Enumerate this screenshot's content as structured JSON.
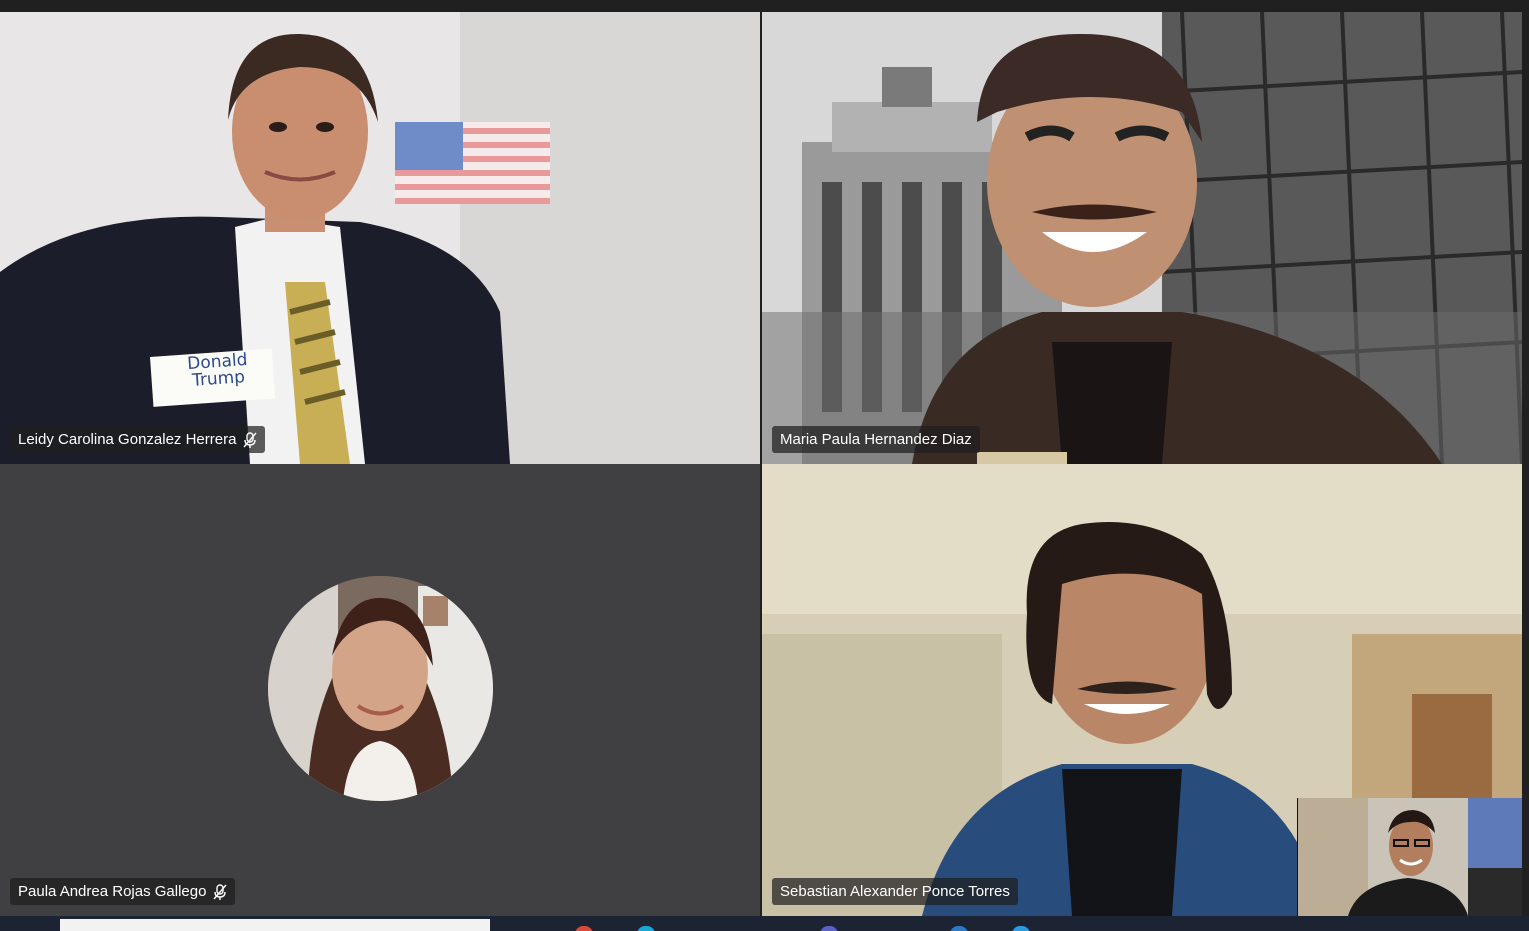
{
  "participants": {
    "tile_1": {
      "name": "Leidy Carolina Gonzalez Herrera",
      "muted": true,
      "name_tag_text": "Donald Trump"
    },
    "tile_2": {
      "name": "Maria Paula Hernandez Diaz",
      "muted": false
    },
    "tile_3": {
      "name": "Paula Andrea Rojas Gallego",
      "muted": true
    },
    "tile_4": {
      "name": "Sebastian Alexander Ponce Torres",
      "muted": false
    }
  },
  "icons": {
    "mute": "mic-off-icon",
    "taskbar_1": "chrome-icon",
    "taskbar_2": "edge-icon",
    "taskbar_3": "teams-icon",
    "taskbar_4": "folder-icon",
    "taskbar_5": "mail-icon"
  },
  "colors": {
    "tile_empty_bg": "#403f41",
    "label_bg": "rgba(30,30,30,0.72)",
    "label_text": "#ffffff"
  }
}
